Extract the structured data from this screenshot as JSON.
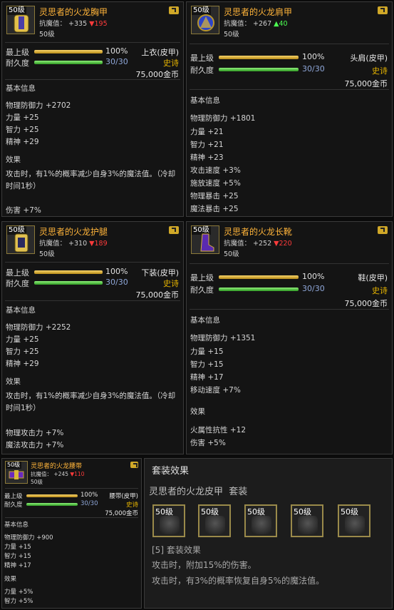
{
  "items": [
    {
      "name": "灵思者的火龙胸甲",
      "resist_label": "抗魔值：",
      "resist_value": "+335",
      "resist_diff": "▼195",
      "level": "50级",
      "icon_level": "50级",
      "req_label": "最上级",
      "req_pct": "100%",
      "dura_label": "耐久度",
      "dura_value": "30/30",
      "slot": "上衣(皮甲)",
      "rarity": "史诗",
      "price": "75,000金币",
      "basic_title": "基本信息",
      "stats": [
        "物理防御力 +2702",
        "力量 +25",
        "智力 +25",
        "精神 +29"
      ],
      "effect_title": "效果",
      "effect_desc": "攻击时，有1%的概率减少自身3%的魔法值。（冷却时间1秒）",
      "effect_stats": [
        "伤害 +7%"
      ]
    },
    {
      "name": "灵思者的火龙肩甲",
      "resist_label": "抗魔值：",
      "resist_value": "+267",
      "resist_diff": "▲40",
      "level": "50级",
      "icon_level": "50级",
      "req_label": "最上级",
      "req_pct": "100%",
      "dura_label": "耐久度",
      "dura_value": "30/30",
      "slot": "头肩(皮甲)",
      "rarity": "史诗",
      "price": "75,000金币",
      "basic_title": "基本信息",
      "stats": [
        "物理防御力 +1801",
        "力量 +21",
        "智力 +21",
        "精神 +23",
        "攻击速度 +3%",
        "施放速度 +5%",
        "物理暴击 +25",
        "魔法暴击 +25"
      ]
    },
    {
      "name": "灵思者的火龙护腿",
      "resist_label": "抗魔值：",
      "resist_value": "+310",
      "resist_diff": "▼189",
      "level": "50级",
      "icon_level": "50级",
      "req_label": "最上级",
      "req_pct": "100%",
      "dura_label": "耐久度",
      "dura_value": "30/30",
      "slot": "下装(皮甲)",
      "rarity": "史诗",
      "price": "75,000金币",
      "basic_title": "基本信息",
      "stats": [
        "物理防御力 +2252",
        "力量 +25",
        "智力 +25",
        "精神 +29"
      ],
      "effect_title": "效果",
      "effect_desc": "攻击时，有1%的概率减少自身3%的魔法值。（冷却时间1秒）",
      "effect_stats": [
        "物理攻击力 +7%",
        "魔法攻击力 +7%"
      ]
    },
    {
      "name": "灵思者的火龙长靴",
      "resist_label": "抗魔值：",
      "resist_value": "+252",
      "resist_diff": "▼220",
      "level": "50级",
      "icon_level": "50级",
      "req_label": "最上级",
      "req_pct": "100%",
      "dura_label": "耐久度",
      "dura_value": "30/30",
      "slot": "鞋(皮甲)",
      "rarity": "史诗",
      "price": "75,000金币",
      "basic_title": "基本信息",
      "stats": [
        "物理防御力 +1351",
        "力量 +15",
        "智力 +15",
        "精神 +17",
        "移动速度 +7%"
      ],
      "effect_title": "效果",
      "effect_stats": [
        "火属性抗性 +12",
        "伤害 +5%"
      ]
    },
    {
      "name": "灵思者的火龙腰带",
      "resist_label": "抗魔值：",
      "resist_value": "+245",
      "resist_diff": "▼110",
      "level": "50级",
      "icon_level": "50级",
      "req_label": "最上级",
      "req_pct": "100%",
      "dura_label": "耐久度",
      "dura_value": "30/30",
      "slot": "腰带(皮甲)",
      "rarity": "史诗",
      "price": "75,000金币",
      "basic_title": "基本信息",
      "stats": [
        "物理防御力 +900",
        "力量 +15",
        "智力 +15",
        "精神 +17"
      ],
      "effect_title": "效果",
      "effect_stats": [
        "力量 +5%",
        "智力 +5%"
      ]
    }
  ],
  "set": {
    "title": "套装效果",
    "set_name": "灵思者的火龙皮甲  套装",
    "slot_level": "50级",
    "bonus_header": "[5] 套装效果",
    "bonus_lines": [
      "攻击时，附加15%的伤害。",
      "攻击时，有3%的概率恢复自身5%的魔法值。"
    ]
  },
  "colors": {
    "name": "#ffb43a",
    "rarity": "#e6b400",
    "durability": "#8fa7d9",
    "diff_down": "#ff3b3b",
    "diff_up": "#4cff52"
  }
}
